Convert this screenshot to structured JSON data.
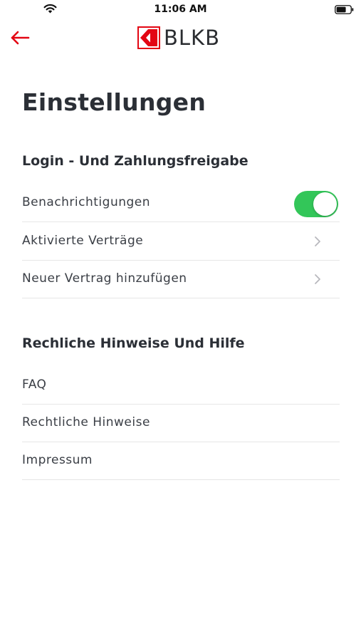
{
  "status_bar": {
    "time": "11:06 AM",
    "wifi_icon": "wifi-icon",
    "battery_icon": "battery-icon"
  },
  "nav": {
    "back_icon": "arrow-left-icon",
    "logo_text": "BLKB",
    "accent_color": "#e30613"
  },
  "page": {
    "title": "Einstellungen"
  },
  "sections": [
    {
      "title": "Login - Und Zahlungsfreigabe",
      "items": [
        {
          "label": "Benachrichtigungen",
          "control": "toggle",
          "toggle_on": true
        },
        {
          "label": "Aktivierte Verträge",
          "control": "chevron"
        },
        {
          "label": "Neuer Vertrag hinzufügen",
          "control": "chevron"
        }
      ]
    },
    {
      "title": "Rechliche Hinweise Und Hilfe",
      "items": [
        {
          "label": "FAQ"
        },
        {
          "label": "Rechtliche Hinweise"
        },
        {
          "label": "Impressum"
        }
      ]
    }
  ],
  "colors": {
    "toggle_on": "#33c659",
    "text": "#2b2f36",
    "divider": "#e6e6e6"
  }
}
